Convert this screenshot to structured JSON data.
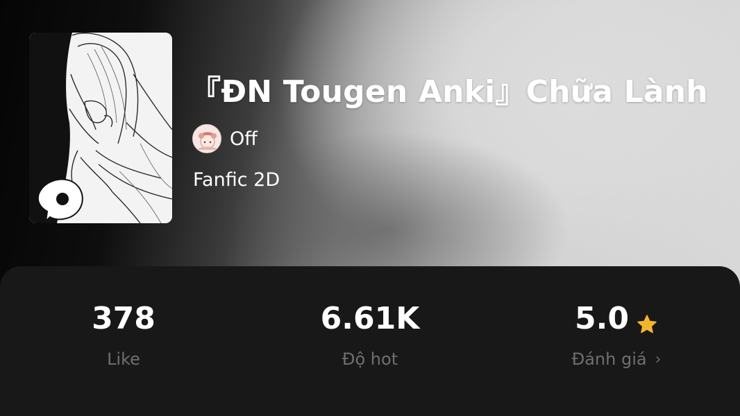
{
  "story": {
    "title": "『ĐN Tougen Anki』Chữa Lành",
    "author": "Off",
    "genre": "Fanfic 2D"
  },
  "stats": {
    "likes": {
      "value": "378",
      "label": "Like"
    },
    "hot": {
      "value": "6.61K",
      "label": "Độ hot"
    },
    "rating": {
      "value": "5.0",
      "label": "Đánh giá"
    }
  },
  "icons": {
    "rating_star": "star-icon",
    "rating_more": "chevron-right-icon",
    "cover_badge": "chat-bubble-icon"
  },
  "colors": {
    "panel_background": "#181818",
    "star": "#f5b52a",
    "label_muted": "#6f6f6f"
  }
}
